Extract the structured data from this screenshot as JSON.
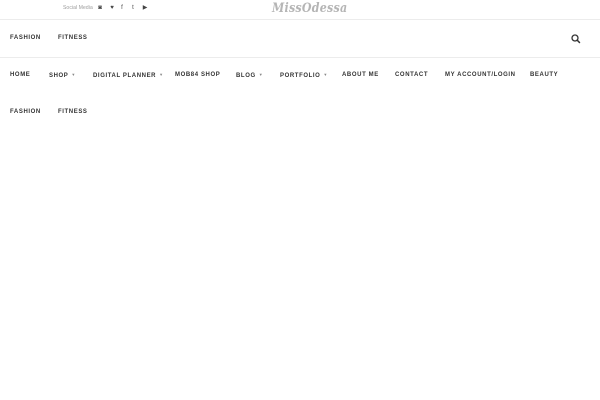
{
  "topbar": {
    "social_label": "Social Media",
    "social_icons": [
      {
        "name": "instagram-icon",
        "glyph": "◙"
      },
      {
        "name": "twitter-icon",
        "glyph": "♥"
      },
      {
        "name": "facebook-icon",
        "glyph": "f"
      },
      {
        "name": "tumblr-icon",
        "glyph": "t"
      },
      {
        "name": "youtube-icon",
        "glyph": "▶"
      }
    ]
  },
  "logo": {
    "text": "MissOdessa"
  },
  "category_bar": {
    "items": [
      "FASHION",
      "FITNESS"
    ],
    "search_icon": "search-icon"
  },
  "main_nav": {
    "items": [
      {
        "label": "HOME",
        "has_dropdown": false
      },
      {
        "label": "SHOP",
        "has_dropdown": true
      },
      {
        "label": "DIGITAL PLANNER",
        "has_dropdown": true
      },
      {
        "label": "MOB84 SHOP",
        "has_dropdown": false
      },
      {
        "label": "BLOG",
        "has_dropdown": true
      },
      {
        "label": "PORTFOLIO",
        "has_dropdown": true
      },
      {
        "label": "ABOUT ME",
        "has_dropdown": false
      },
      {
        "label": "CONTACT",
        "has_dropdown": false
      },
      {
        "label": "MY ACCOUNT/LOGIN",
        "has_dropdown": false
      },
      {
        "label": "BEAUTY",
        "has_dropdown": false
      }
    ]
  },
  "sub_nav": {
    "items": [
      "FASHION",
      "FITNESS"
    ]
  }
}
